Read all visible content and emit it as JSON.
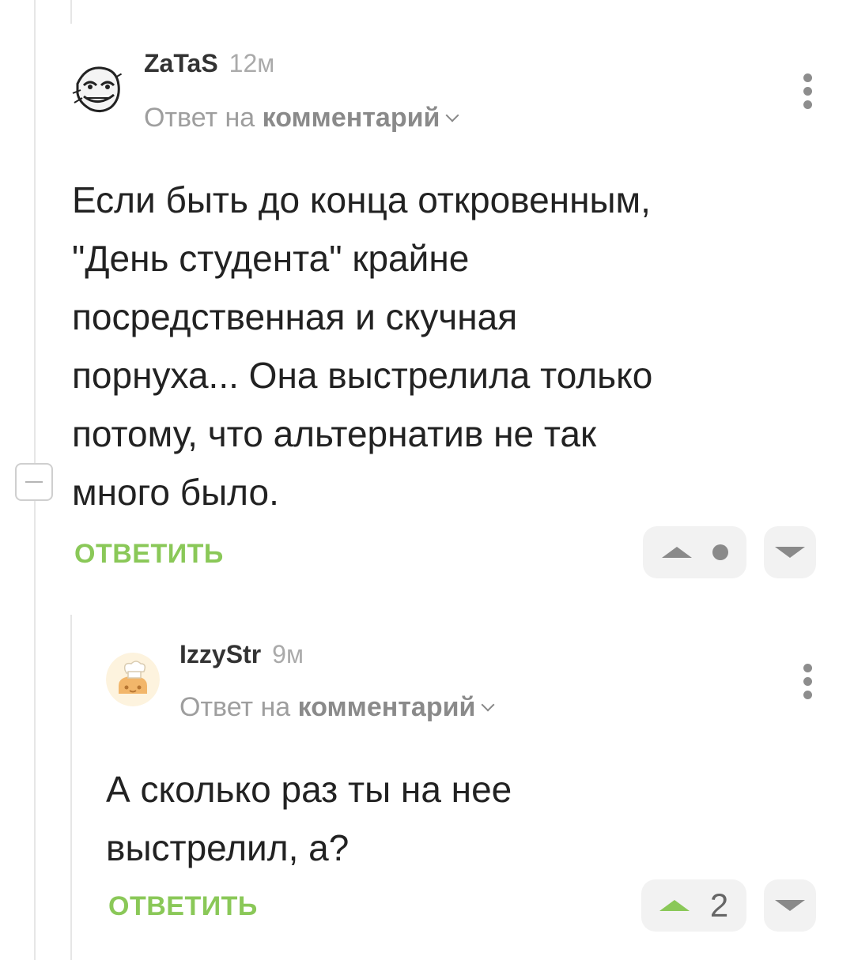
{
  "comments": [
    {
      "author": "ZaTaS",
      "time": "12м",
      "reply_prefix": "Ответ на",
      "reply_target": "комментарий",
      "text_lines": [
        "Если быть до конца откровенным,",
        "\"День студента\" крайне",
        "посредственная и скучная",
        "порнуха... Она выстрелила только",
        "потому, что альтернатив не так",
        "много было."
      ],
      "reply_label": "ОТВЕТИТЬ",
      "rating": null
    },
    {
      "author": "IzzyStr",
      "time": "9м",
      "reply_prefix": "Ответ на",
      "reply_target": "комментарий",
      "text_lines": [
        "А сколько раз ты на нее",
        "выстрелил, а?"
      ],
      "reply_label": "ОТВЕТИТЬ",
      "rating": "2"
    }
  ],
  "colors": {
    "accent_green": "#8ac858",
    "vote_bg": "#f2f2f2"
  },
  "icons": [
    "collapse-icon",
    "kebab-menu-icon",
    "chevron-down-icon",
    "upvote-icon",
    "downvote-icon"
  ]
}
